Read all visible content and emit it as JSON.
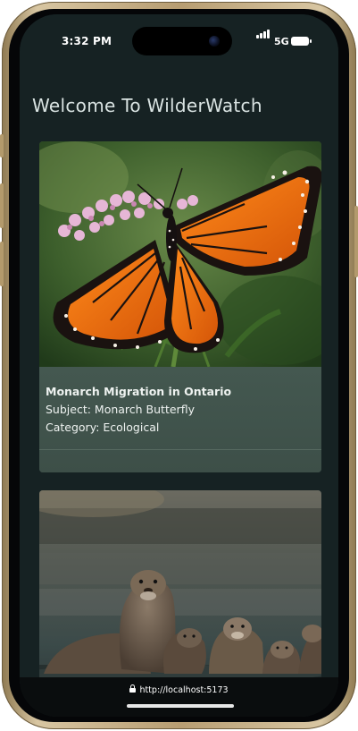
{
  "status_bar": {
    "time": "3:32 PM",
    "network": "5G",
    "icons": [
      "signal-icon",
      "battery-icon"
    ]
  },
  "page": {
    "title": "Welcome To WilderWatch"
  },
  "cards": [
    {
      "title": "Monarch Migration in Ontario",
      "subject": "Subject: Monarch Butterfly",
      "category": "Category: Ecological",
      "image": "monarch-butterfly-photo"
    },
    {
      "image": "otters-photo"
    }
  ],
  "browser": {
    "url": "http://localhost:5173",
    "icons": [
      "lock-icon"
    ]
  }
}
